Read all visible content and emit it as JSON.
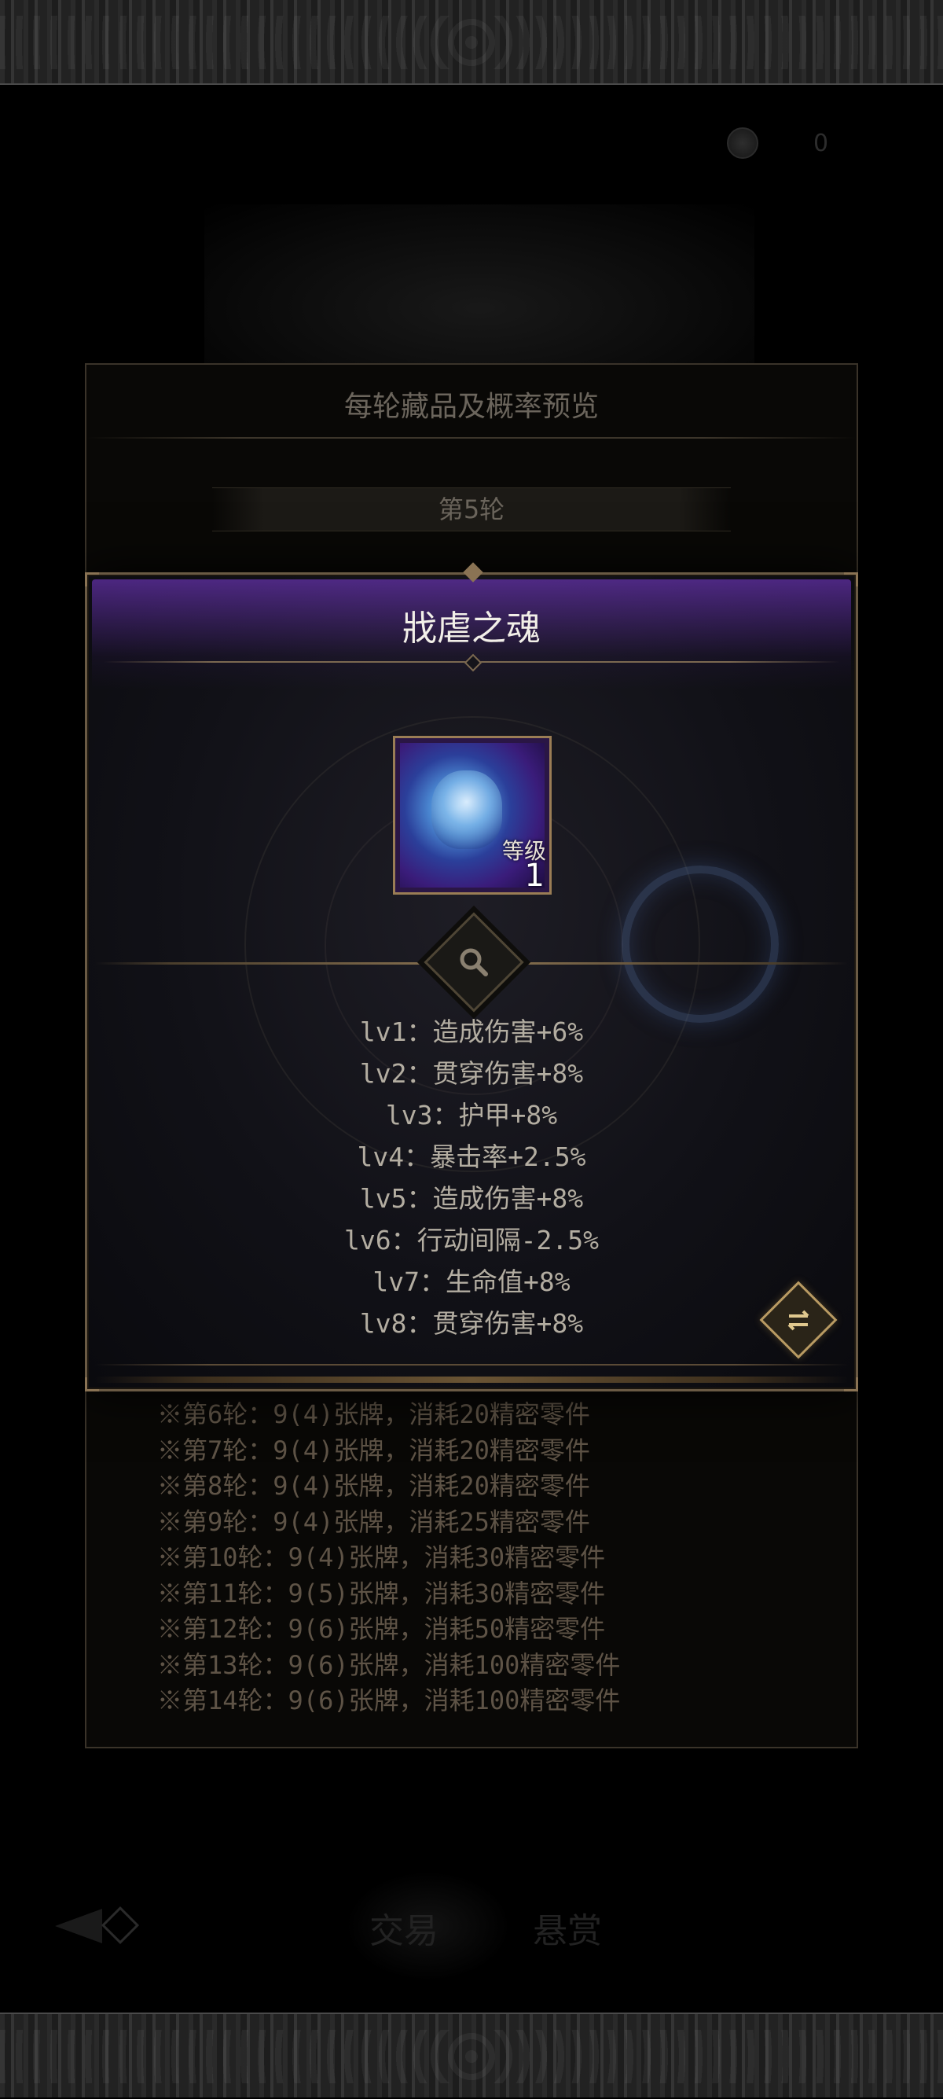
{
  "header": {
    "currency_value": "0"
  },
  "panel": {
    "title": "每轮藏品及概率预览",
    "round_tab": "第5轮",
    "cost_rows": [
      "※第6轮：9(4)张牌，消耗20精密零件",
      "※第7轮：9(4)张牌，消耗20精密零件",
      "※第8轮：9(4)张牌，消耗20精密零件",
      "※第9轮：9(4)张牌，消耗25精密零件",
      "※第10轮：9(4)张牌，消耗30精密零件",
      "※第11轮：9(5)张牌，消耗30精密零件",
      "※第12轮：9(6)张牌，消耗50精密零件",
      "※第13轮：9(6)张牌，消耗100精密零件",
      "※第14轮：9(6)张牌，消耗100精密零件"
    ]
  },
  "item": {
    "name": "戕虐之魂",
    "level_label": "等级",
    "level_value": "1",
    "rarity_color": "#7a3cd8",
    "icon": "blue-spirit-skull-icon",
    "effects": [
      "lv1：造成伤害+6%",
      "lv2：贯穿伤害+8%",
      "lv3：护甲+8%",
      "lv4：暴击率+2.5%",
      "lv5：造成伤害+8%",
      "lv6：行动间隔-2.5%",
      "lv7：生命值+8%",
      "lv8：贯穿伤害+8%"
    ]
  },
  "bottom_nav": {
    "tabs": [
      "交易",
      "悬赏"
    ]
  },
  "colors": {
    "accent_gold": "#b89a62",
    "text_muted": "#5e5346",
    "modal_bg": "#111117"
  }
}
